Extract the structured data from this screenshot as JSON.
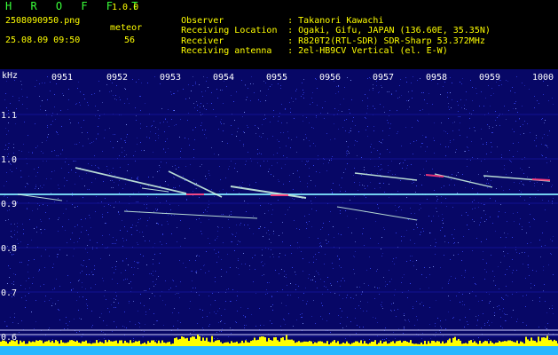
{
  "header": {
    "app_title": "H R O F F T",
    "app_version": "1.0.0",
    "file_name": "2508090950.png",
    "datetime": "25.08.09 09:50",
    "detector_label": "meteor",
    "detector_count": "56",
    "info": [
      {
        "key": "Observer",
        "value": "Takanori Kawachi"
      },
      {
        "key": "Receiving Location",
        "value": "Ogaki, Gifu, JAPAN (136.60E, 35.35N)"
      },
      {
        "key": "Receiver",
        "value": "R820T2(RTL-SDR) SDR-Sharp 53.372MHz"
      },
      {
        "key": "Receiving antenna",
        "value": "2el-HB9CV Vertical (el. E-W)"
      }
    ]
  },
  "spectrogram": {
    "unit": "kHz",
    "time_labels": [
      "0951",
      "0952",
      "0953",
      "0954",
      "0955",
      "0956",
      "0957",
      "0958",
      "0959",
      "1000"
    ],
    "freq_labels": [
      "1.1",
      "1.0",
      "0.9",
      "0.8",
      "0.7",
      "0.6"
    ],
    "colors": {
      "background": "#0a0a78",
      "noise": "#3b4cff",
      "carrier": "#7fe6ff",
      "meteor": "#d6ffe6",
      "hot": "#ff3a7a",
      "amplitude": "#ffff00",
      "amplitude_base": "#27b7ff"
    }
  }
}
